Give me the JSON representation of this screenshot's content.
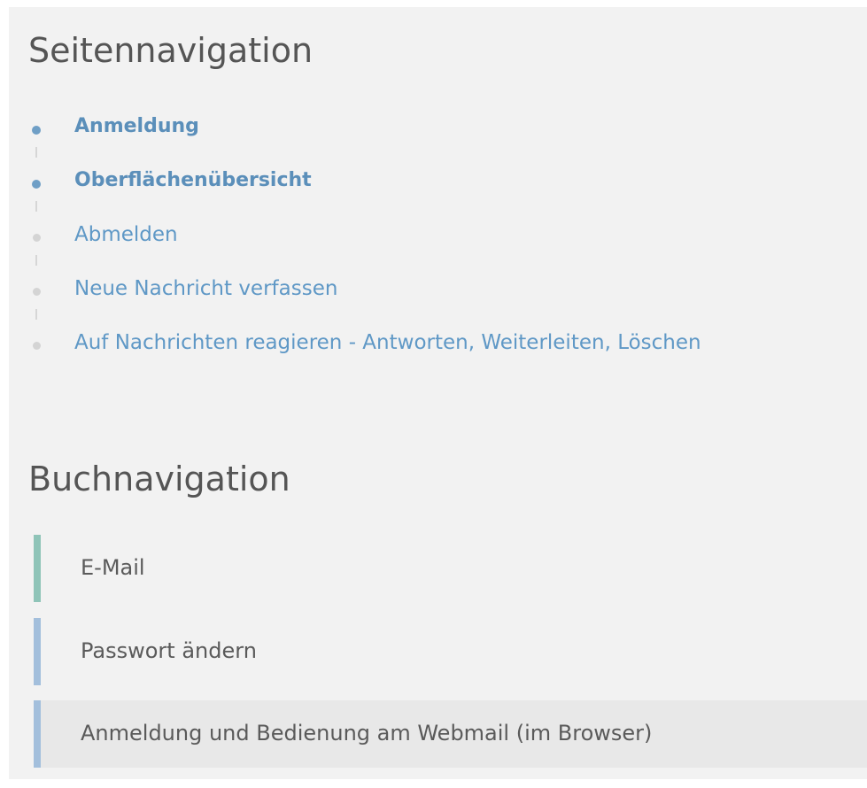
{
  "page_nav": {
    "title": "Seitennavigation",
    "items": [
      {
        "label": "Anmeldung",
        "state": "active"
      },
      {
        "label": "Oberflächenübersicht",
        "state": "active"
      },
      {
        "label": "Abmelden",
        "state": "inactive"
      },
      {
        "label": "Neue Nachricht verfassen",
        "state": "inactive"
      },
      {
        "label": "Auf Nachrichten reagieren - Antworten, Weiterleiten, Löschen",
        "state": "inactive"
      }
    ]
  },
  "book_nav": {
    "title": "Buchnavigation",
    "items": [
      {
        "label": "E-Mail",
        "accent_color": "#8fc4b8"
      },
      {
        "label": "Passwort ändern",
        "accent_color": "#a3bfdc"
      },
      {
        "label": "Anmeldung und Bedienung am Webmail (im Browser)",
        "accent_color": "#a3bfdc",
        "highlighted": true
      }
    ]
  },
  "colors": {
    "panel_background": "#f2f2f2",
    "link": "#5f98c6",
    "active_dot": "#6f9fc6",
    "inactive_dot": "#d4d4d4"
  }
}
